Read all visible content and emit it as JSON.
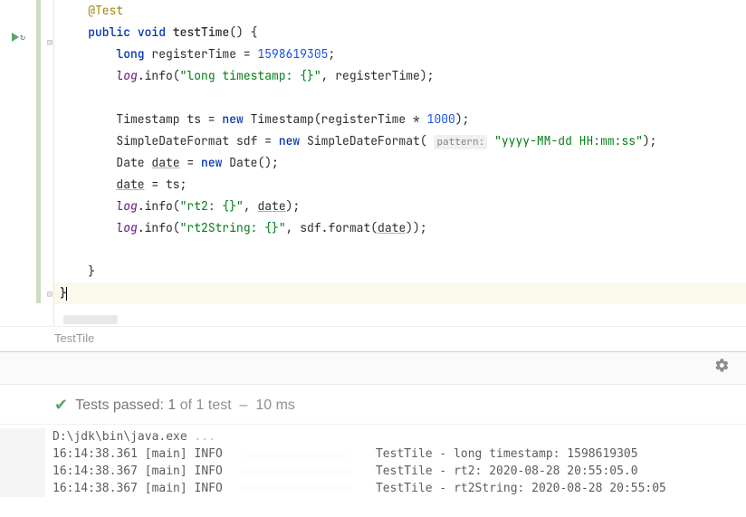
{
  "code": {
    "annotation": "@Test",
    "sig_kw1": "public",
    "sig_kw2": "void",
    "sig_name": "testTime",
    "sig_paren": "() {",
    "l_long": "long",
    "l_var": "registerTime = ",
    "l_val": "1598619305",
    "semicolon": ";",
    "log": "log",
    "info": ".info(",
    "s1": "\"long timestamp: {}\"",
    "cm": ", registerTime);",
    "ts_decl": "Timestamp ts = ",
    "kw_new": "new",
    "ts_ctor": " Timestamp(registerTime * ",
    "thousand": "1000",
    "paren_sc": ");",
    "sdf_decl": "SimpleDateFormat sdf = ",
    "sdf_ctor": " SimpleDateFormat(",
    "param_hint": "pattern:",
    "sdf_pat": "\"yyyy-MM-dd HH:mm:ss\"",
    "date_decl1": "Date ",
    "date_var": "date",
    "date_eq": " = ",
    "date_ctor": " Date();",
    "date_assign_l": "date",
    "date_assign_r": " = ts;",
    "s2": "\"rt2: {}\"",
    "s2_rest": ", ",
    "s2_arg": "date",
    "s2_end": ");",
    "s3": "\"rt2String: {}\"",
    "s3_rest": ", sdf.format(",
    "s3_arg": "date",
    "s3_end": "));",
    "close1": "}",
    "close2": "}"
  },
  "breadcrumb": "TestTile",
  "test": {
    "label": "Tests passed:",
    "count": "1",
    "total": "of 1 test",
    "sep": "–",
    "time": "10 ms"
  },
  "console": {
    "cmd": "D:\\jdk\\bin\\java.exe ",
    "dots": "...",
    "lines": [
      {
        "ts": "16:14:38.361 [main] INFO  ",
        "msg": "TestTile - long timestamp: 1598619305"
      },
      {
        "ts": "16:14:38.367 [main] INFO  ",
        "msg": "TestTile - rt2: 2020-08-28 20:55:05.0"
      },
      {
        "ts": "16:14:38.367 [main] INFO  ",
        "msg": "TestTile - rt2String: 2020-08-28 20:55:05"
      }
    ]
  }
}
